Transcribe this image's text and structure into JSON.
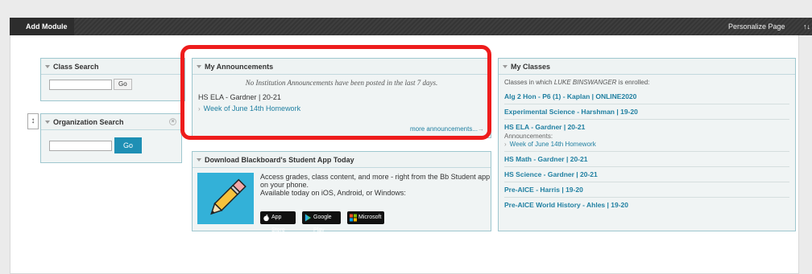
{
  "toolbar": {
    "add_module": "Add Module",
    "personalize": "Personalize Page",
    "sort_glyph": "↑↓"
  },
  "class_search": {
    "title": "Class Search",
    "go": "Go"
  },
  "org_search": {
    "title": "Organization Search",
    "go": "Go",
    "drag_glyph": "↕",
    "close_glyph": "×"
  },
  "announcements": {
    "title": "My Announcements",
    "none_msg": "No Institution Announcements have been posted in the last 7 days.",
    "course": "HS ELA - Gardner | 20-21",
    "item": "Week of June 14th Homework",
    "more": "more announcements...",
    "more_arrow": "→"
  },
  "bb_app": {
    "title": "Download Blackboard's Student App Today",
    "line1": "Access grades, class content, and more - right from the Bb Student app on your phone.",
    "line2": "Available today on iOS, Android, or Windows:",
    "stores": [
      "App Store",
      "Google Play",
      "Microsoft"
    ]
  },
  "my_classes": {
    "title": "My Classes",
    "intro_prefix": "Classes in which ",
    "user": "LUKE BINSWANGER",
    "intro_suffix": " is enrolled:",
    "items": [
      "Alg 2 Hon - P6 (1) - Kaplan | ONLINE2020",
      "Experimental Science - Harshman | 19-20",
      "HS ELA - Gardner | 20-21",
      "HS Math - Gardner | 20-21",
      "HS Science - Gardner | 20-21",
      "Pre-AICE - Harris | 19-20",
      "Pre-AICE World History - Ahles | 19-20"
    ],
    "ela_sub_label": "Announcements:",
    "ela_sub_item": "Week of June 14th Homework"
  },
  "colors": {
    "link": "#1f7fa1",
    "highlight": "#ee1c1c",
    "go_blue": "#1e8fb4",
    "app_tile": "#33b1d8"
  }
}
